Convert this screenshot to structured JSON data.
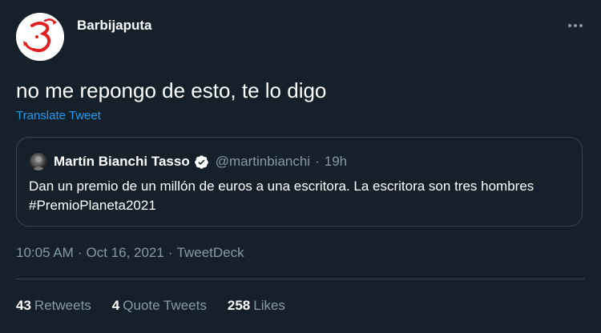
{
  "tweet": {
    "author_name": "Barbijaputa",
    "text": "no me repongo de esto, te lo digo",
    "translate_label": "Translate Tweet"
  },
  "quoted": {
    "name": "Martín Bianchi Tasso",
    "handle": "@martinbianchi",
    "separator": "·",
    "time": "19h",
    "text": "Dan un premio de un millón de euros a una escritora. La escritora son tres hombres #PremioPlaneta2021"
  },
  "meta": {
    "time": "10:05 AM",
    "sep": "·",
    "date": "Oct 16, 2021",
    "source": "TweetDeck"
  },
  "stats": [
    {
      "value": "43",
      "label": "Retweets"
    },
    {
      "value": "4",
      "label": "Quote Tweets"
    },
    {
      "value": "258",
      "label": "Likes"
    }
  ],
  "colors": {
    "background": "#15202b",
    "accent": "#1d9bf0",
    "secondary_text": "#8899a6",
    "border": "#38444d",
    "logo_red": "#e0201f"
  },
  "icons": {
    "avatar": "devil-logo-avatar",
    "more": "more-dots-icon",
    "verified": "verified-badge-icon"
  }
}
